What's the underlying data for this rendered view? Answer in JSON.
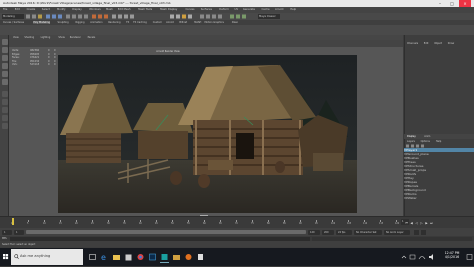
{
  "window": {
    "title": "Autodesk Maya 2016: D:\\Work\\Forest Village\\scenes\\forest_village_final_v03.mb* --- forest_village_final_v03.mb"
  },
  "menubar": [
    "File",
    "Edit",
    "Create",
    "Select",
    "Modify",
    "Display",
    "Windows",
    "Mesh",
    "Edit Mesh",
    "Mesh Tools",
    "Mesh Display",
    "Curves",
    "Surfaces",
    "Deform",
    "UV",
    "Generate",
    "Cache",
    "Arnold",
    "Help"
  ],
  "status": {
    "mode": "Modeling",
    "workspace": "Maya Classic"
  },
  "shelf_tabs": [
    "Curves / Surfaces",
    "Poly Modeling",
    "Sculpting",
    "Rigging",
    "Animation",
    "Rendering",
    "FX",
    "FX Caching",
    "Custom",
    "Arnold",
    "Bifrost",
    "MASH",
    "Motion Graphics",
    "XGen"
  ],
  "viewport": {
    "menu": [
      "View",
      "Shading",
      "Lighting",
      "Show",
      "Renderer",
      "Panels"
    ],
    "camera_label": "persp",
    "hud": [
      {
        "label": "Verts:",
        "v1": "482360",
        "v2": "0",
        "v3": "0"
      },
      {
        "label": "Edges:",
        "v1": "958205",
        "v2": "0",
        "v3": "0"
      },
      {
        "label": "Faces:",
        "v1": "476421",
        "v2": "0",
        "v3": "0"
      },
      {
        "label": "Tris:",
        "v1": "951034",
        "v2": "0",
        "v3": "0"
      },
      {
        "label": "UVs:",
        "v1": "523118",
        "v2": "0",
        "v3": "0"
      }
    ],
    "render_title": "Arnold Render View"
  },
  "right_panel": {
    "tabs": [
      "Channels",
      "Edit",
      "Object",
      "Show"
    ],
    "layer_tabs": [
      "Display",
      "Anim"
    ],
    "layer_menu": [
      "Layers",
      "Options",
      "Help"
    ],
    "layers": [
      {
        "name": "layer1",
        "color": "#3a6bd0",
        "selected": true
      },
      {
        "name": "Ground_plane",
        "color": "#c03030"
      },
      {
        "name": "Bushes",
        "color": "#7a3a8a"
      },
      {
        "name": "Trees",
        "color": "#c03030"
      },
      {
        "name": "Structures",
        "color": "#c03030"
      },
      {
        "name": "Small_props",
        "color": "#c03030"
      },
      {
        "name": "Roofs",
        "color": "#c03030"
      },
      {
        "name": "Hay",
        "color": "#c03030"
      },
      {
        "name": "Ropes",
        "color": "#c03030"
      },
      {
        "name": "Barrels",
        "color": "#c03030"
      },
      {
        "name": "Background",
        "color": "#c03030"
      },
      {
        "name": "Rocks",
        "color": "#c03030"
      },
      {
        "name": "Water",
        "color": "#c03030"
      }
    ]
  },
  "timeline": {
    "ticks": [
      "1",
      "5",
      "10",
      "15",
      "20",
      "25",
      "30",
      "35",
      "40",
      "45",
      "50",
      "55",
      "60",
      "65",
      "70",
      "75",
      "80",
      "85",
      "90",
      "95",
      "100",
      "105",
      "110",
      "115",
      "120"
    ],
    "current_frame": "1",
    "range_start": "1",
    "range_end": "120",
    "anim_end": "200",
    "fps": "24 fps",
    "no_char_set": "No Character Set",
    "no_anim_layer": "No Anim Layer"
  },
  "cmd_label": "MEL",
  "help_line": "Select Tool: select an object",
  "taskbar": {
    "search_placeholder": "Ask me anything",
    "time": "12:47 PM",
    "date": "4/1/2016"
  }
}
